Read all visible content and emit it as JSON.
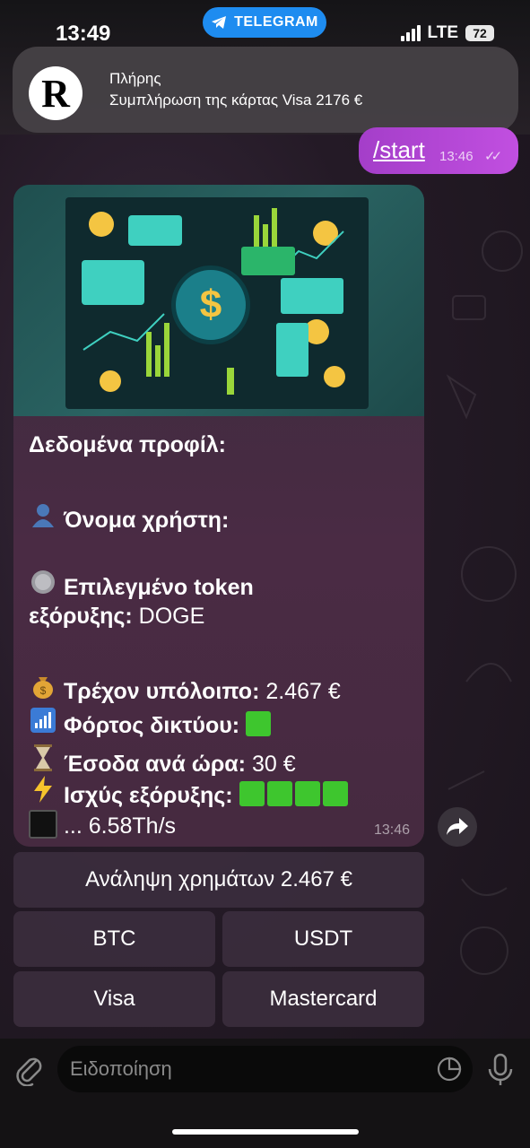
{
  "status_bar": {
    "time": "13:49",
    "app_pill": "TELEGRAM",
    "network": "LTE",
    "battery": "72"
  },
  "notification": {
    "title": "Πλήρης",
    "body": "Συμπλήρωση της κάρτας Visa 2176 €"
  },
  "outgoing": {
    "text": "/start",
    "time": "13:46"
  },
  "bot_message": {
    "header": "Δεδομένα προφίλ:",
    "username_label": "Όνομα χρήστη:",
    "token_label_1": "Επιλεγμένο token",
    "token_label_2": "εξόρυξης:",
    "token_value": "DOGE",
    "balance_label": "Τρέχον υπόλοιπο:",
    "balance_value": "2.467 €",
    "load_label": "Φόρτος δικτύου:",
    "income_label": "Έσοδα ανά ώρα:",
    "income_value": "30 €",
    "power_label": "Ισχύς εξόρυξης:",
    "hashrate": "... 6.58Th/s",
    "time": "13:46"
  },
  "keyboard": {
    "withdraw": "Ανάληψη χρημάτων 2.467 €",
    "btc": "BTC",
    "usdt": "USDT",
    "visa": "Visa",
    "mastercard": "Mastercard"
  },
  "composer": {
    "placeholder": "Ειδοποίηση"
  }
}
